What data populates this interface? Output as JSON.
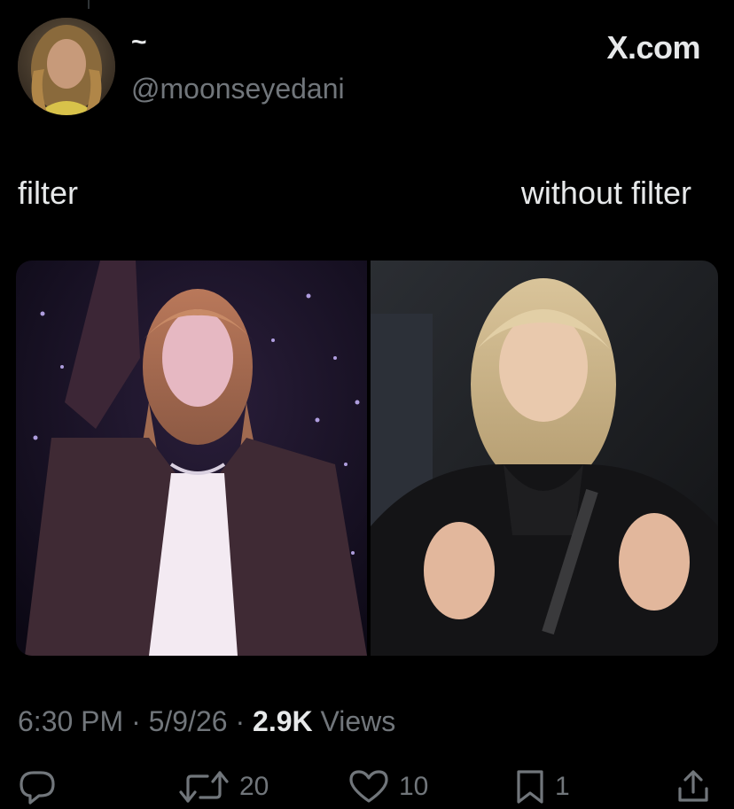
{
  "author": {
    "display_name": "~",
    "handle": "@moonseyedani",
    "avatar_alt": "avatar"
  },
  "brand": {
    "label": "X.com"
  },
  "post": {
    "caption_left": "filter",
    "caption_right": "without filter"
  },
  "meta": {
    "time": "6:30 PM",
    "separator1": " · ",
    "date": "5/9/26",
    "separator2": " · ",
    "views_count": "2.9K",
    "views_label": " Views"
  },
  "actions": {
    "reply_count": "",
    "repost_count": "20",
    "like_count": "10",
    "bookmark_count": "1"
  },
  "icons": {
    "reply": "reply-icon",
    "repost": "repost-icon",
    "like": "heart-icon",
    "bookmark": "bookmark-icon",
    "share": "share-icon"
  },
  "colors": {
    "background": "#000000",
    "text_primary": "#e7e9ea",
    "text_secondary": "#71767b"
  }
}
